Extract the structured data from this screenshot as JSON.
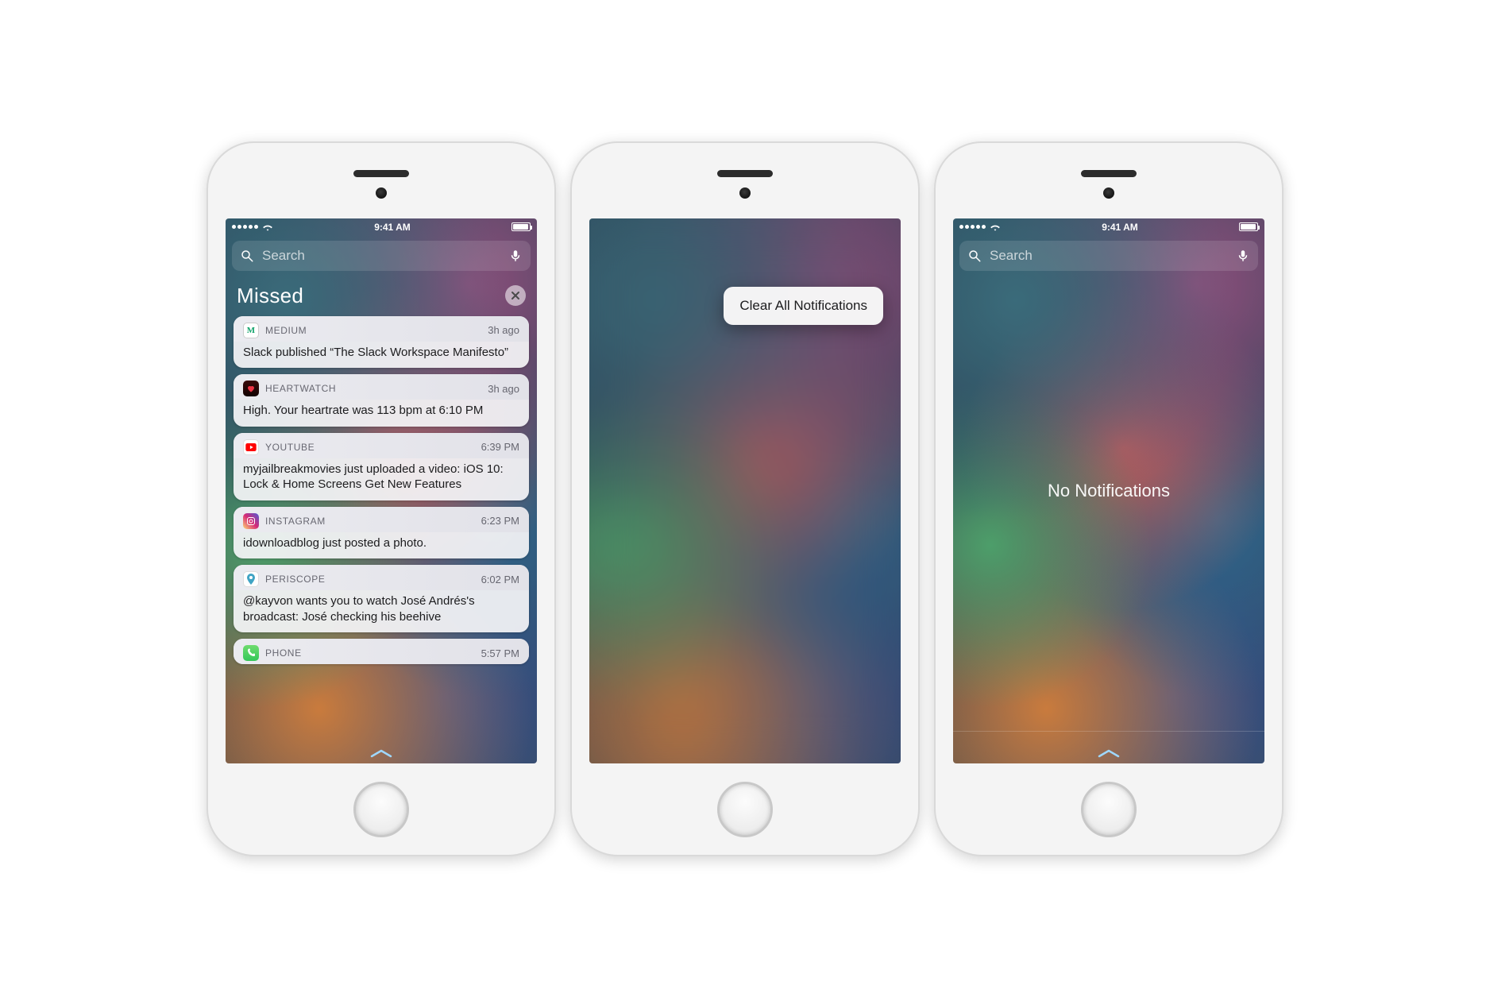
{
  "status": {
    "time": "9:41 AM"
  },
  "search": {
    "placeholder": "Search"
  },
  "phone1": {
    "section_title": "Missed",
    "notifications": [
      {
        "app": "MEDIUM",
        "time": "3h ago",
        "body": "Slack published “The Slack Workspace Manifesto”",
        "icon": "ic-medium"
      },
      {
        "app": "HEARTWATCH",
        "time": "3h ago",
        "body": "High. Your heartrate was 113 bpm at 6:10 PM",
        "icon": "ic-heart"
      },
      {
        "app": "YOUTUBE",
        "time": "6:39 PM",
        "body": "myjailbreakmovies just uploaded a video: iOS 10: Lock & Home Screens Get New Features",
        "icon": "ic-youtube"
      },
      {
        "app": "INSTAGRAM",
        "time": "6:23 PM",
        "body": "idownloadblog just posted a photo.",
        "icon": "ic-instagram"
      },
      {
        "app": "PERISCOPE",
        "time": "6:02 PM",
        "body": "@kayvon wants you to watch José Andrés's broadcast: José checking his beehive",
        "icon": "ic-periscope"
      },
      {
        "app": "PHONE",
        "time": "5:57 PM",
        "body": "",
        "icon": "ic-phone"
      }
    ]
  },
  "phone2": {
    "popup_label": "Clear All Notifications"
  },
  "phone3": {
    "empty_label": "No Notifications"
  }
}
